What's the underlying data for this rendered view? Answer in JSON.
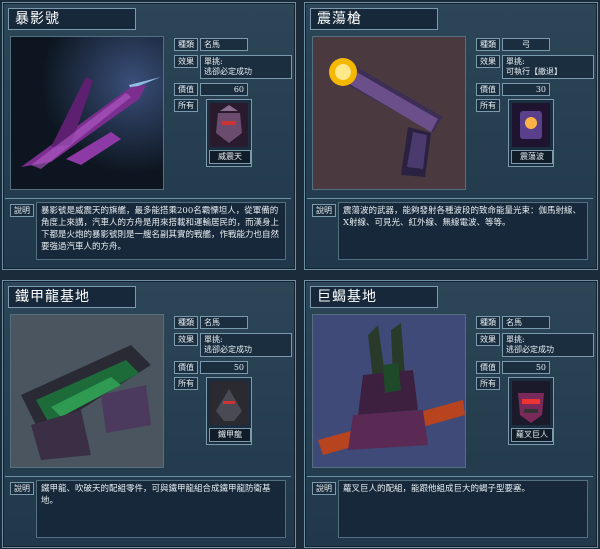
{
  "labels": {
    "kind": "種類",
    "effect": "效果",
    "value": "價值",
    "owner": "所有",
    "desc": "說明"
  },
  "cards": [
    {
      "name": "暴影號",
      "kind": "名馬",
      "effect": "單挑:\n逃卻必定成功",
      "value": "60",
      "owner": "威震天",
      "desc": "暴影號是威震天的旗艦，最多能搭乘200名霸慄坦人，從軍備的角度上來講，汽車人的方舟是用來搭載和運輸居民的，而漢身上下都是火炮的暴影號則是一艘名副其實的戰艦，作戰能力也自然要強過汽車人的方舟。"
    },
    {
      "name": "震蕩槍",
      "kind": "弓",
      "effect": "單挑:\n可執行【繳退】",
      "value": "30",
      "owner": "震蕩波",
      "desc": "震蕩波的武器，能夠發射各種波段的致命能量光束：伽馬射線、X射線、可見光、紅外線、無線電波、等等。"
    },
    {
      "name": "鐵甲龍基地",
      "kind": "名馬",
      "effect": "單挑:\n逃卻必定成功",
      "value": "50",
      "owner": "鐵甲龍",
      "desc": "鐵甲龍、吹破天的配組零件，可與鐵甲龍組合成鐵甲龍防衛基地。"
    },
    {
      "name": "巨蝎基地",
      "kind": "名馬",
      "effect": "單挑:\n逃卻必定成功",
      "value": "50",
      "owner": "蘿叉巨人",
      "desc": "蘿叉巨人的配組，能跟他組成巨大的蝎子型要塞。"
    }
  ]
}
